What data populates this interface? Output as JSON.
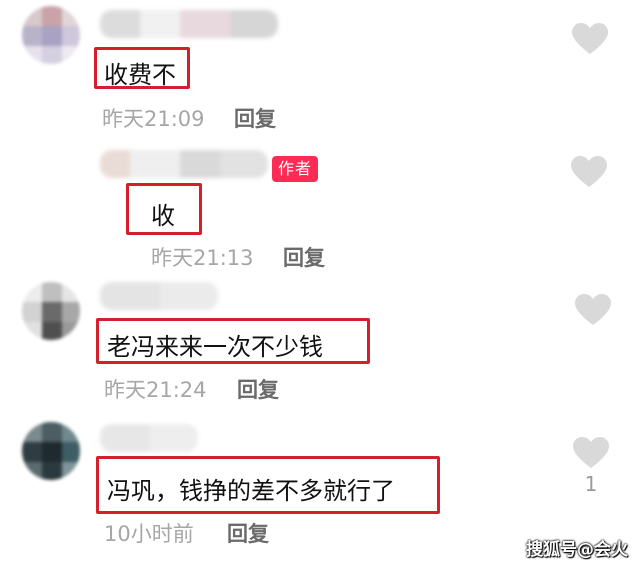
{
  "comments": [
    {
      "text": "收费不",
      "time": "昨天21:09",
      "reply_label": "回复"
    },
    {
      "text": "收",
      "badge": "作者",
      "time": "昨天21:13",
      "reply_label": "回复"
    },
    {
      "text": "老冯来来一次不少钱",
      "time": "昨天21:24",
      "reply_label": "回复"
    },
    {
      "text": "冯巩，钱挣的差不多就行了",
      "time": "10小时前",
      "reply_label": "回复",
      "likes": "1"
    }
  ],
  "watermark": "搜狐号@会火",
  "colors": {
    "highlight_border": "#d4202c",
    "author_badge": "#fe2c55",
    "heart": "#d9d9d9"
  },
  "icons": {
    "like": "heart-icon"
  }
}
